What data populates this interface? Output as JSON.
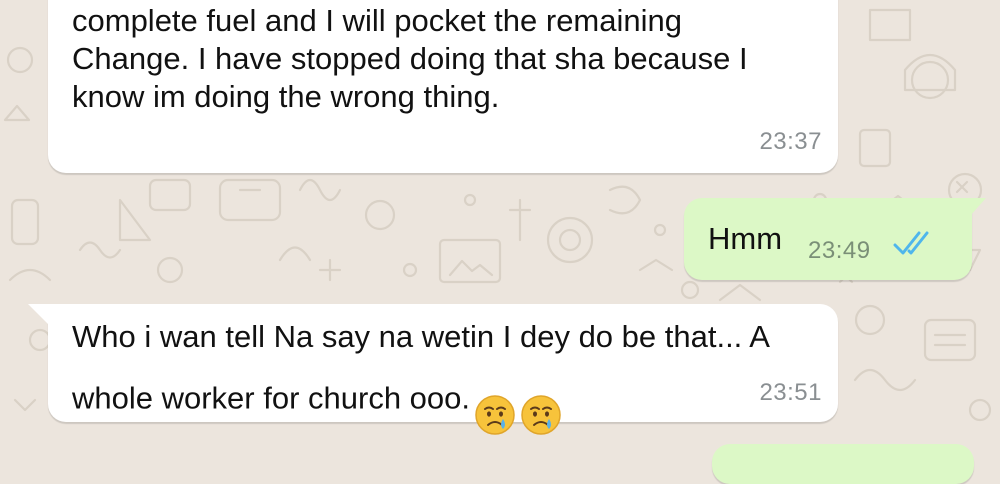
{
  "theme": {
    "background": "#ece5dd",
    "incoming_bubble": "#ffffff",
    "outgoing_bubble": "#dcf8c6",
    "read_tick_color": "#4fb6ec"
  },
  "messages": [
    {
      "direction": "incoming",
      "text": "morning for church service,  I will not buy all the\ncomplete fuel and I will pocket the remaining\nChange.  I have stopped doing that sha because I\nknow im doing the wrong thing.",
      "time": "23:37"
    },
    {
      "direction": "outgoing",
      "text": "Hmm",
      "time": "23:49",
      "status_icon": "double-check-read-icon"
    },
    {
      "direction": "incoming",
      "text": "Who i wan tell Na say na wetin I dey do be that... A\nwhole worker for church ooo.",
      "time": "23:51",
      "emojis": [
        "crying-face-emoji",
        "crying-face-emoji"
      ]
    },
    {
      "direction": "outgoing",
      "text": "",
      "time": ""
    }
  ]
}
